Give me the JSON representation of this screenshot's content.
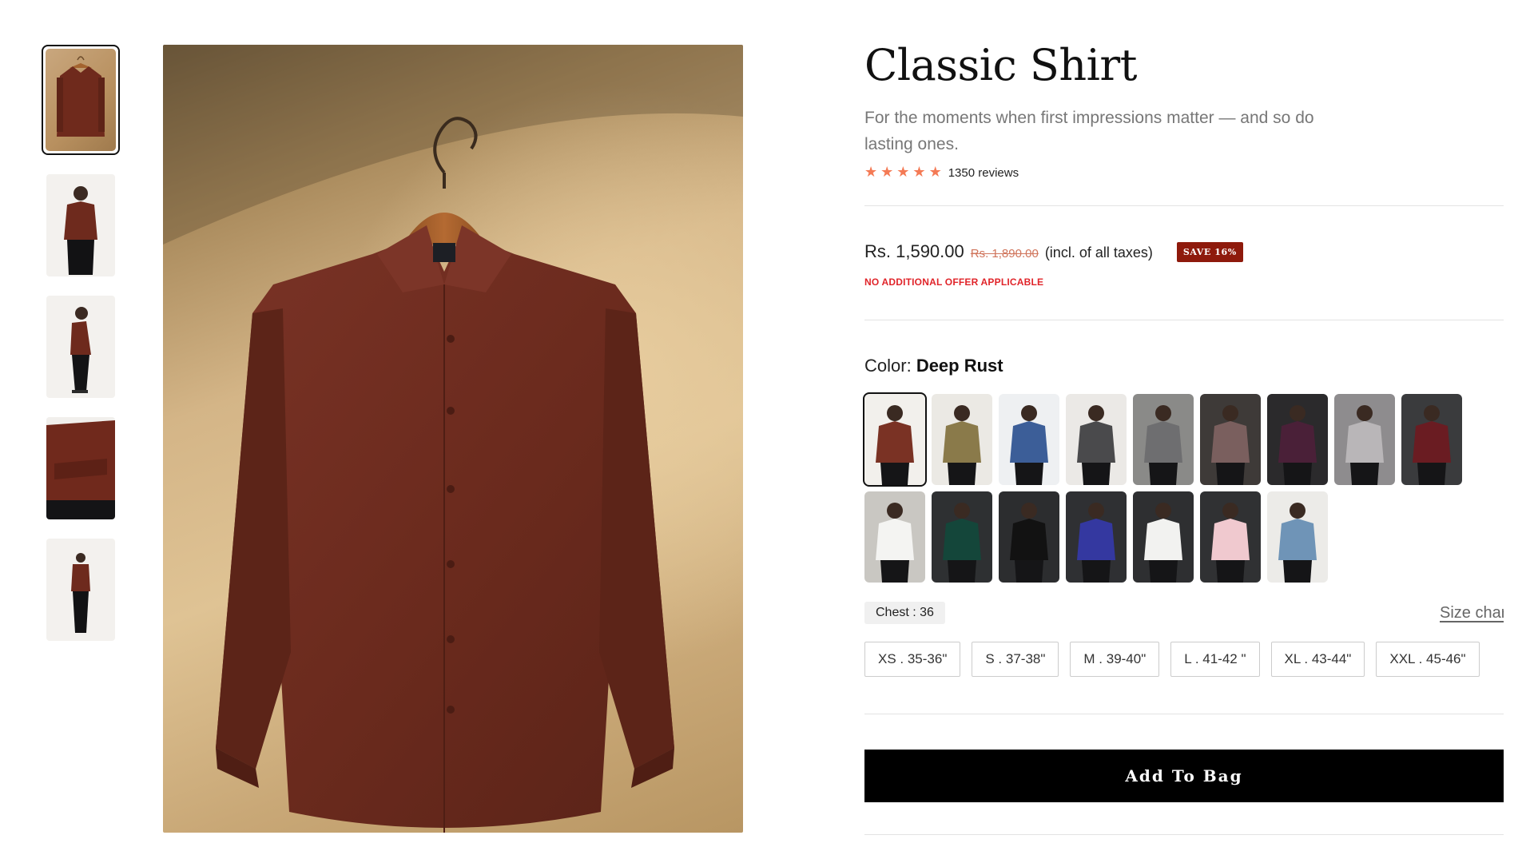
{
  "gallery": {
    "thumbnails": [
      "hanger-front",
      "model-front-hands-on-hips",
      "model-side-looking-down",
      "model-arms-crossed-closeup",
      "model-full-length"
    ],
    "selected_index": 0
  },
  "product": {
    "title": "Classic Shirt",
    "subtitle": "For the moments when first impressions matter — and so do lasting ones.",
    "rating_stars": 5,
    "reviews_label": "1350 reviews",
    "price": "Rs. 1,590.00",
    "mrp": "Rs. 1,890.00",
    "tax_note": "(incl. of all taxes)",
    "save_badge": "SAVE 16%",
    "offer_note": "NO ADDITIONAL OFFER APPLICABLE"
  },
  "color": {
    "label": "Color:",
    "selected_name": "Deep Rust",
    "swatches": [
      {
        "name": "deep-rust",
        "hex": "#7a3224",
        "bg": "#f2f0ec"
      },
      {
        "name": "olive",
        "hex": "#8a7a4a",
        "bg": "#ebe9e4"
      },
      {
        "name": "royal-blue",
        "hex": "#3c5e98",
        "bg": "#eef0f2"
      },
      {
        "name": "charcoal-grey",
        "hex": "#4a4a4c",
        "bg": "#ebe9e6"
      },
      {
        "name": "grey",
        "hex": "#6e6e70",
        "bg": "#8a8a88"
      },
      {
        "name": "mauve-taupe",
        "hex": "#7a5f5e",
        "bg": "#3e3a38"
      },
      {
        "name": "purple",
        "hex": "#4a2038",
        "bg": "#2b2a2c"
      },
      {
        "name": "light-grey",
        "hex": "#b9b6b8",
        "bg": "#8e8c8e"
      },
      {
        "name": "maroon",
        "hex": "#6a1c22",
        "bg": "#3a3b3d"
      },
      {
        "name": "white",
        "hex": "#f4f4f2",
        "bg": "#c9c7c2"
      },
      {
        "name": "bottle-green",
        "hex": "#14463a",
        "bg": "#2e3032"
      },
      {
        "name": "black",
        "hex": "#121212",
        "bg": "#2c2d2f"
      },
      {
        "name": "electric-blue",
        "hex": "#3438a0",
        "bg": "#2f3033"
      },
      {
        "name": "white-2",
        "hex": "#f2f2f0",
        "bg": "#2e2f31"
      },
      {
        "name": "pink",
        "hex": "#f0c9cf",
        "bg": "#303133"
      },
      {
        "name": "sky-blue",
        "hex": "#6f94b7",
        "bg": "#ecebe8"
      }
    ]
  },
  "size": {
    "chest_chip": "Chest : 36",
    "size_chart_label": "Size chart",
    "options": [
      "XS . 35-36\"",
      "S . 37-38\"",
      "M . 39-40\"",
      "L . 41-42 \"",
      "XL . 43-44\"",
      "XXL . 45-46\""
    ]
  },
  "cta": {
    "add_to_bag": "Add To Bag"
  }
}
